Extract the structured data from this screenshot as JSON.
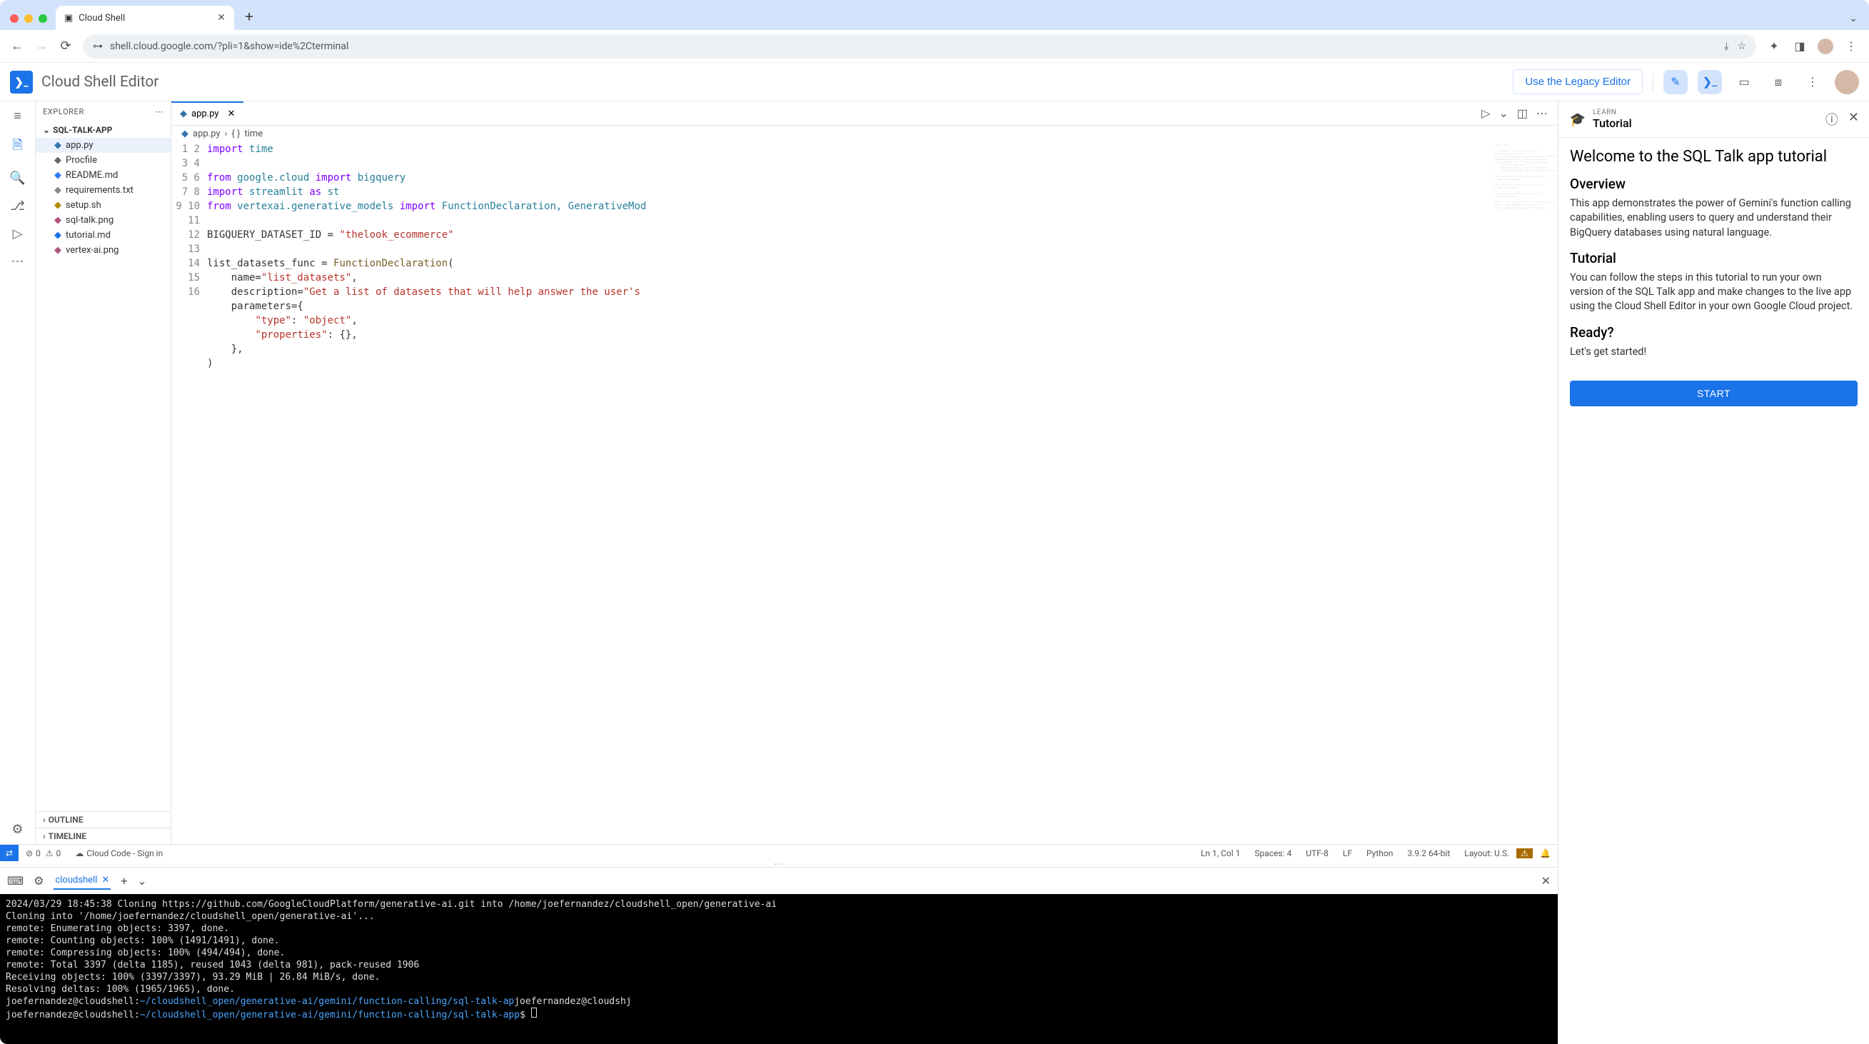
{
  "browser": {
    "tab_title": "Cloud Shell",
    "url": "shell.cloud.google.com/?pli=1&show=ide%2Cterminal"
  },
  "app_header": {
    "title": "Cloud Shell Editor",
    "legacy_button": "Use the Legacy Editor"
  },
  "activity": {
    "menu": "≡"
  },
  "explorer": {
    "header": "EXPLORER",
    "project": "SQL-TALK-APP",
    "files": [
      {
        "name": "app.py",
        "icon": "py",
        "selected": true
      },
      {
        "name": "Procfile",
        "icon": "proc"
      },
      {
        "name": "README.md",
        "icon": "info"
      },
      {
        "name": "requirements.txt",
        "icon": "txt"
      },
      {
        "name": "setup.sh",
        "icon": "sh"
      },
      {
        "name": "sql-talk.png",
        "icon": "img"
      },
      {
        "name": "tutorial.md",
        "icon": "md"
      },
      {
        "name": "vertex-ai.png",
        "icon": "img"
      }
    ],
    "outline": "OUTLINE",
    "timeline": "TIMELINE"
  },
  "editor": {
    "tab": "app.py",
    "breadcrumb_file": "app.py",
    "breadcrumb_symbol": "time",
    "gutter": [
      "1",
      "2",
      "3",
      "4",
      "5",
      "6",
      "7",
      "8",
      "9",
      "10",
      "11",
      "12",
      "13",
      "14",
      "15",
      "16"
    ]
  },
  "statusbar": {
    "errors": "0",
    "warnings": "0",
    "cloudcode": "Cloud Code - Sign in",
    "pos": "Ln 1, Col 1",
    "spaces": "Spaces: 4",
    "enc": "UTF-8",
    "eol": "LF",
    "lang": "Python",
    "py": "3.9.2 64-bit",
    "layout": "Layout: U.S."
  },
  "terminal": {
    "tab": "cloudshell",
    "lines": [
      "2024/03/29 18:45:38 Cloning https://github.com/GoogleCloudPlatform/generative-ai.git into /home/joefernandez/cloudshell_open/generative-ai",
      "Cloning into '/home/joefernandez/cloudshell_open/generative-ai'...",
      "remote: Enumerating objects: 3397, done.",
      "remote: Counting objects: 100% (1491/1491), done.",
      "remote: Compressing objects: 100% (494/494), done.",
      "remote: Total 3397 (delta 1185), reused 1043 (delta 981), pack-reused 1906",
      "Receiving objects: 100% (3397/3397), 93.29 MiB | 26.84 MiB/s, done.",
      "Resolving deltas: 100% (1965/1965), done."
    ],
    "prompt_user": "joefernandez@cloudshell",
    "prompt_path1": "~/cloudshell_open/generative-ai/gemini/function-calling/sql-talk-ap",
    "prompt_trail": "joefernandez@cloudshj",
    "prompt_path2": "~/cloudshell_open/generative-ai/gemini/function-calling/sql-talk-app"
  },
  "tutorial": {
    "learn": "LEARN",
    "title": "Tutorial",
    "h1": "Welcome to the SQL Talk app tutorial",
    "overview_h": "Overview",
    "overview_p": "This app demonstrates the power of Gemini's function calling capabilities, enabling users to query and understand their BigQuery databases using natural language.",
    "tutorial_h": "Tutorial",
    "tutorial_p": "You can follow the steps in this tutorial to run your own version of the SQL Talk app and make changes to the live app using the Cloud Shell Editor in your own Google Cloud project.",
    "ready_h": "Ready?",
    "ready_p": "Let's get started!",
    "start": "START"
  }
}
